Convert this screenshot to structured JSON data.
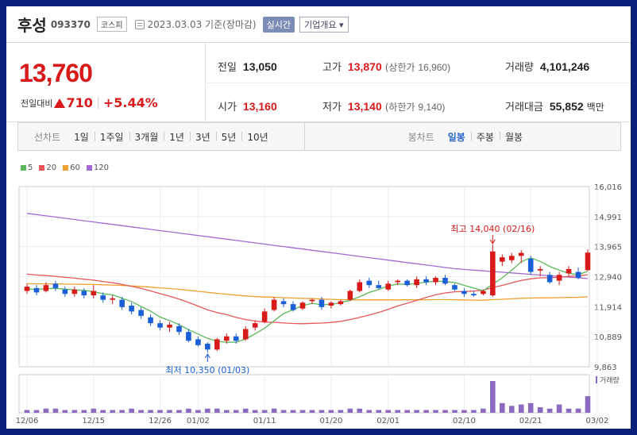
{
  "header": {
    "stock_name": "후성",
    "stock_code": "093370",
    "market": "코스피",
    "date_text": "2023.03.03 기준(장마감)",
    "realtime_label": "실시간",
    "company_label": "기업개요 ▾"
  },
  "summary": {
    "price": "13,760",
    "change_label": "전일대비",
    "change_amount": "710",
    "change_pct": "+5.44%",
    "prev_close_label": "전일",
    "prev_close": "13,050",
    "high_label": "고가",
    "high": "13,870",
    "upper_limit_label": "(상한가",
    "upper_limit": "16,960)",
    "volume_label": "거래량",
    "volume": "4,101,246",
    "open_label": "시가",
    "open": "13,160",
    "low_label": "저가",
    "low": "13,140",
    "lower_limit_label": "(하한가",
    "lower_limit": "9,140)",
    "amount_label": "거래대금",
    "amount": "55,852",
    "amount_unit": "백만"
  },
  "tabs": {
    "line_label": "선차트",
    "line_tabs": [
      "1일",
      "1주일",
      "3개월",
      "1년",
      "3년",
      "5년",
      "10년"
    ],
    "candle_label": "봉차트",
    "candle_tabs": [
      "일봉",
      "주봉",
      "월봉"
    ],
    "active_candle": "일봉"
  },
  "colors": {
    "up": "#d81a1a",
    "down": "#1a5fd8",
    "ma5": "#5cb85c",
    "ma20": "#e8585a",
    "ma60": "#f0a030",
    "ma120": "#a36ad6"
  },
  "chart_data": {
    "type": "candlestick",
    "legend": [
      {
        "name": "5",
        "color": "#5cb85c"
      },
      {
        "name": "20",
        "color": "#e8585a"
      },
      {
        "name": "60",
        "color": "#f0a030"
      },
      {
        "name": "120",
        "color": "#a36ad6"
      }
    ],
    "y_ticks": [
      "16,016",
      "14,991",
      "13,965",
      "12,940",
      "11,914",
      "10,889",
      "9,863"
    ],
    "ylim": [
      9863,
      16016
    ],
    "x_ticks": [
      "12/06",
      "12/15",
      "12/26",
      "01/02",
      "01/11",
      "01/20",
      "02/01",
      "02/10",
      "02/21",
      "03/02"
    ],
    "x_tick_index": [
      0,
      7,
      14,
      18,
      25,
      32,
      38,
      46,
      53,
      60
    ],
    "volume_label": "거래량",
    "high_annotation": "최고 14,040 (02/16)",
    "low_annotation": "최저 10,350 (01/03)",
    "high_index": 49,
    "low_index": 19,
    "candles": [
      {
        "o": 12450,
        "c": 12600,
        "h": 12700,
        "l": 12350
      },
      {
        "o": 12550,
        "c": 12400,
        "h": 12650,
        "l": 12300
      },
      {
        "o": 12450,
        "c": 12650,
        "h": 12750,
        "l": 12400
      },
      {
        "o": 12700,
        "c": 12550,
        "h": 12800,
        "l": 12450
      },
      {
        "o": 12500,
        "c": 12350,
        "h": 12600,
        "l": 12250
      },
      {
        "o": 12350,
        "c": 12500,
        "h": 12600,
        "l": 12250
      },
      {
        "o": 12450,
        "c": 12300,
        "h": 12550,
        "l": 12200
      },
      {
        "o": 12300,
        "c": 12450,
        "h": 12650,
        "l": 12200
      },
      {
        "o": 12300,
        "c": 12150,
        "h": 12400,
        "l": 12050
      },
      {
        "o": 12150,
        "c": 12200,
        "h": 12300,
        "l": 12000
      },
      {
        "o": 12150,
        "c": 11900,
        "h": 12250,
        "l": 11800
      },
      {
        "o": 11950,
        "c": 11750,
        "h": 12050,
        "l": 11650
      },
      {
        "o": 11800,
        "c": 11600,
        "h": 11900,
        "l": 11500
      },
      {
        "o": 11550,
        "c": 11350,
        "h": 11650,
        "l": 11250
      },
      {
        "o": 11350,
        "c": 11200,
        "h": 11450,
        "l": 11100
      },
      {
        "o": 11200,
        "c": 11300,
        "h": 11400,
        "l": 11050
      },
      {
        "o": 11250,
        "c": 11050,
        "h": 11350,
        "l": 10950
      },
      {
        "o": 11050,
        "c": 10750,
        "h": 11150,
        "l": 10700
      },
      {
        "o": 10800,
        "c": 10600,
        "h": 10900,
        "l": 10550
      },
      {
        "o": 10650,
        "c": 10450,
        "h": 10700,
        "l": 10350
      },
      {
        "o": 10450,
        "c": 10800,
        "h": 10850,
        "l": 10400
      },
      {
        "o": 10750,
        "c": 10900,
        "h": 11000,
        "l": 10650
      },
      {
        "o": 10900,
        "c": 10750,
        "h": 11000,
        "l": 10650
      },
      {
        "o": 10800,
        "c": 11150,
        "h": 11250,
        "l": 10750
      },
      {
        "o": 11200,
        "c": 11350,
        "h": 11450,
        "l": 11100
      },
      {
        "o": 11400,
        "c": 11750,
        "h": 11850,
        "l": 11350
      },
      {
        "o": 11800,
        "c": 12150,
        "h": 12250,
        "l": 11750
      },
      {
        "o": 12100,
        "c": 12000,
        "h": 12200,
        "l": 11900
      },
      {
        "o": 12000,
        "c": 11800,
        "h": 12100,
        "l": 11750
      },
      {
        "o": 11850,
        "c": 12050,
        "h": 12100,
        "l": 11800
      },
      {
        "o": 12100,
        "c": 12150,
        "h": 12200,
        "l": 12000
      },
      {
        "o": 12150,
        "c": 11900,
        "h": 12250,
        "l": 11800
      },
      {
        "o": 11950,
        "c": 12050,
        "h": 12100,
        "l": 11850
      },
      {
        "o": 12000,
        "c": 12100,
        "h": 12150,
        "l": 11950
      },
      {
        "o": 12150,
        "c": 12450,
        "h": 12500,
        "l": 12100
      },
      {
        "o": 12450,
        "c": 12750,
        "h": 12850,
        "l": 12400
      },
      {
        "o": 12800,
        "c": 12650,
        "h": 12900,
        "l": 12550
      },
      {
        "o": 12650,
        "c": 12550,
        "h": 12800,
        "l": 12500
      },
      {
        "o": 12500,
        "c": 12700,
        "h": 12800,
        "l": 12450
      },
      {
        "o": 12750,
        "c": 12800,
        "h": 12850,
        "l": 12650
      },
      {
        "o": 12800,
        "c": 12650,
        "h": 12850,
        "l": 12600
      },
      {
        "o": 12650,
        "c": 12850,
        "h": 12950,
        "l": 12550
      },
      {
        "o": 12850,
        "c": 12750,
        "h": 12950,
        "l": 12650
      },
      {
        "o": 12750,
        "c": 12900,
        "h": 12950,
        "l": 12650
      },
      {
        "o": 12900,
        "c": 12700,
        "h": 13000,
        "l": 12650
      },
      {
        "o": 12650,
        "c": 12500,
        "h": 12700,
        "l": 12450
      },
      {
        "o": 12450,
        "c": 12350,
        "h": 12550,
        "l": 12250
      },
      {
        "o": 12350,
        "c": 12300,
        "h": 12450,
        "l": 12250
      },
      {
        "o": 12350,
        "c": 12450,
        "h": 12500,
        "l": 12300
      },
      {
        "o": 12300,
        "c": 13800,
        "h": 14040,
        "l": 12250
      },
      {
        "o": 13450,
        "c": 13600,
        "h": 13700,
        "l": 13300
      },
      {
        "o": 13500,
        "c": 13650,
        "h": 13750,
        "l": 13400
      },
      {
        "o": 13650,
        "c": 13750,
        "h": 13850,
        "l": 13400
      },
      {
        "o": 13550,
        "c": 13100,
        "h": 13650,
        "l": 13000
      },
      {
        "o": 13150,
        "c": 13200,
        "h": 13300,
        "l": 12950
      },
      {
        "o": 13000,
        "c": 12750,
        "h": 13100,
        "l": 12700
      },
      {
        "o": 12800,
        "c": 13000,
        "h": 13100,
        "l": 12650
      },
      {
        "o": 13050,
        "c": 13200,
        "h": 13300,
        "l": 12950
      },
      {
        "o": 13100,
        "c": 12900,
        "h": 13250,
        "l": 12850
      },
      {
        "o": 13160,
        "c": 13760,
        "h": 13870,
        "l": 13140
      }
    ],
    "volume": [
      2,
      2,
      3,
      3,
      2,
      2,
      2,
      3,
      2,
      2,
      2,
      3,
      2,
      2,
      2,
      2,
      2,
      3,
      2,
      3,
      3,
      2,
      2,
      3,
      2,
      2,
      3,
      2,
      2,
      2,
      2,
      2,
      2,
      2,
      3,
      3,
      2,
      2,
      2,
      2,
      2,
      2,
      2,
      2,
      2,
      2,
      2,
      2,
      3,
      23,
      7,
      5,
      6,
      7,
      4,
      3,
      6,
      3,
      3,
      12
    ]
  }
}
